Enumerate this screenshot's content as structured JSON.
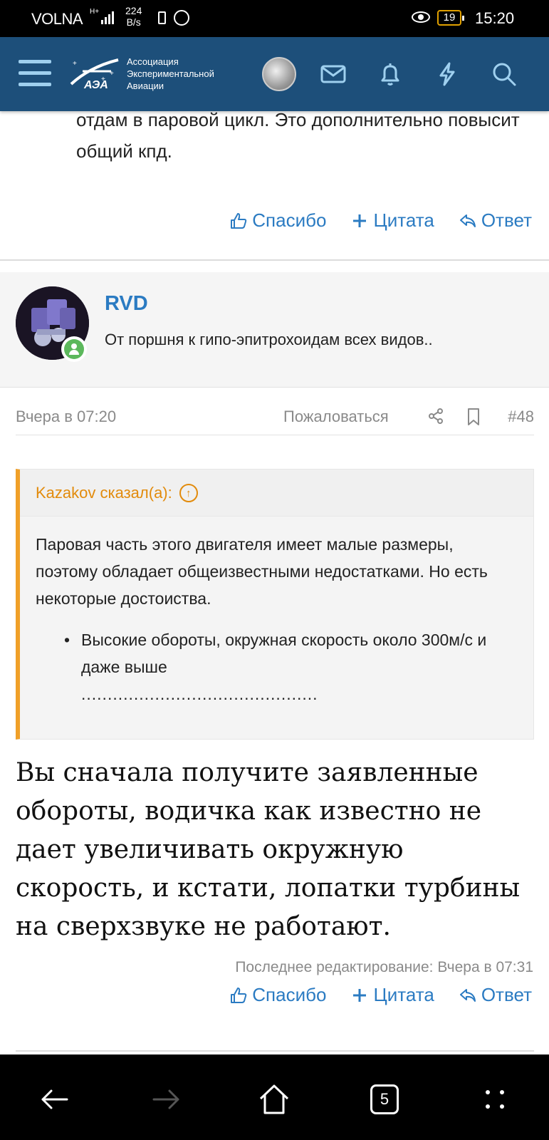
{
  "status_bar": {
    "carrier": "VOLNA",
    "network": "H+",
    "speed_value": "224",
    "speed_unit": "B/s",
    "battery": "19",
    "time": "15:20"
  },
  "header": {
    "logo_abbr": "АЭА",
    "logo_line1": "Ассоциация",
    "logo_line2": "Экспериментальной",
    "logo_line3": "Авиации"
  },
  "prev_post": {
    "text_tail": "отдам в паровой цикл. Это дополнительно повысит общий кпд.",
    "actions": {
      "like": "Спасибо",
      "quote": "Цитата",
      "reply": "Ответ"
    }
  },
  "post": {
    "author": "RVD",
    "user_title": "От поршня к гипо-эпитрохоидам всех видов..",
    "date": "Вчера в 07:20",
    "report": "Пожаловаться",
    "number": "#48",
    "quote": {
      "author": "Kazakov сказал(а):",
      "text": "Паровая часть этого двигателя имеет малые размеры, поэтому обладает общеизвестными недостатками. Но есть некоторые достоиства.",
      "list_item": "Высокие обороты, окружная скорость около 300м/с и даже выше",
      "dots": "............................................."
    },
    "body": "Вы сначала получите заявленные обороты, водичка как известно не дает увеличивать окружную скорость, и кстати, лопатки турбины на сверхзвуке не работают.",
    "edited": "Последнее редактирование: Вчера в 07:31",
    "actions": {
      "like": "Спасибо",
      "quote": "Цитата",
      "reply": "Ответ"
    }
  },
  "navbar": {
    "tab_count": "5"
  },
  "colors": {
    "header_bg": "#1d4f7a",
    "link": "#2b7bc2",
    "quote_accent": "#f0a028",
    "online": "#5cb85c"
  },
  "icons": {
    "header": [
      "menu-icon",
      "mail-icon",
      "bell-icon",
      "lightning-icon",
      "search-icon"
    ],
    "actions": [
      "thumbs-up-icon",
      "plus-icon",
      "reply-icon"
    ],
    "meta": [
      "share-icon",
      "bookmark-icon"
    ],
    "nav": [
      "back-arrow-icon",
      "forward-arrow-icon",
      "home-icon",
      "tabs-icon",
      "more-icon"
    ]
  }
}
